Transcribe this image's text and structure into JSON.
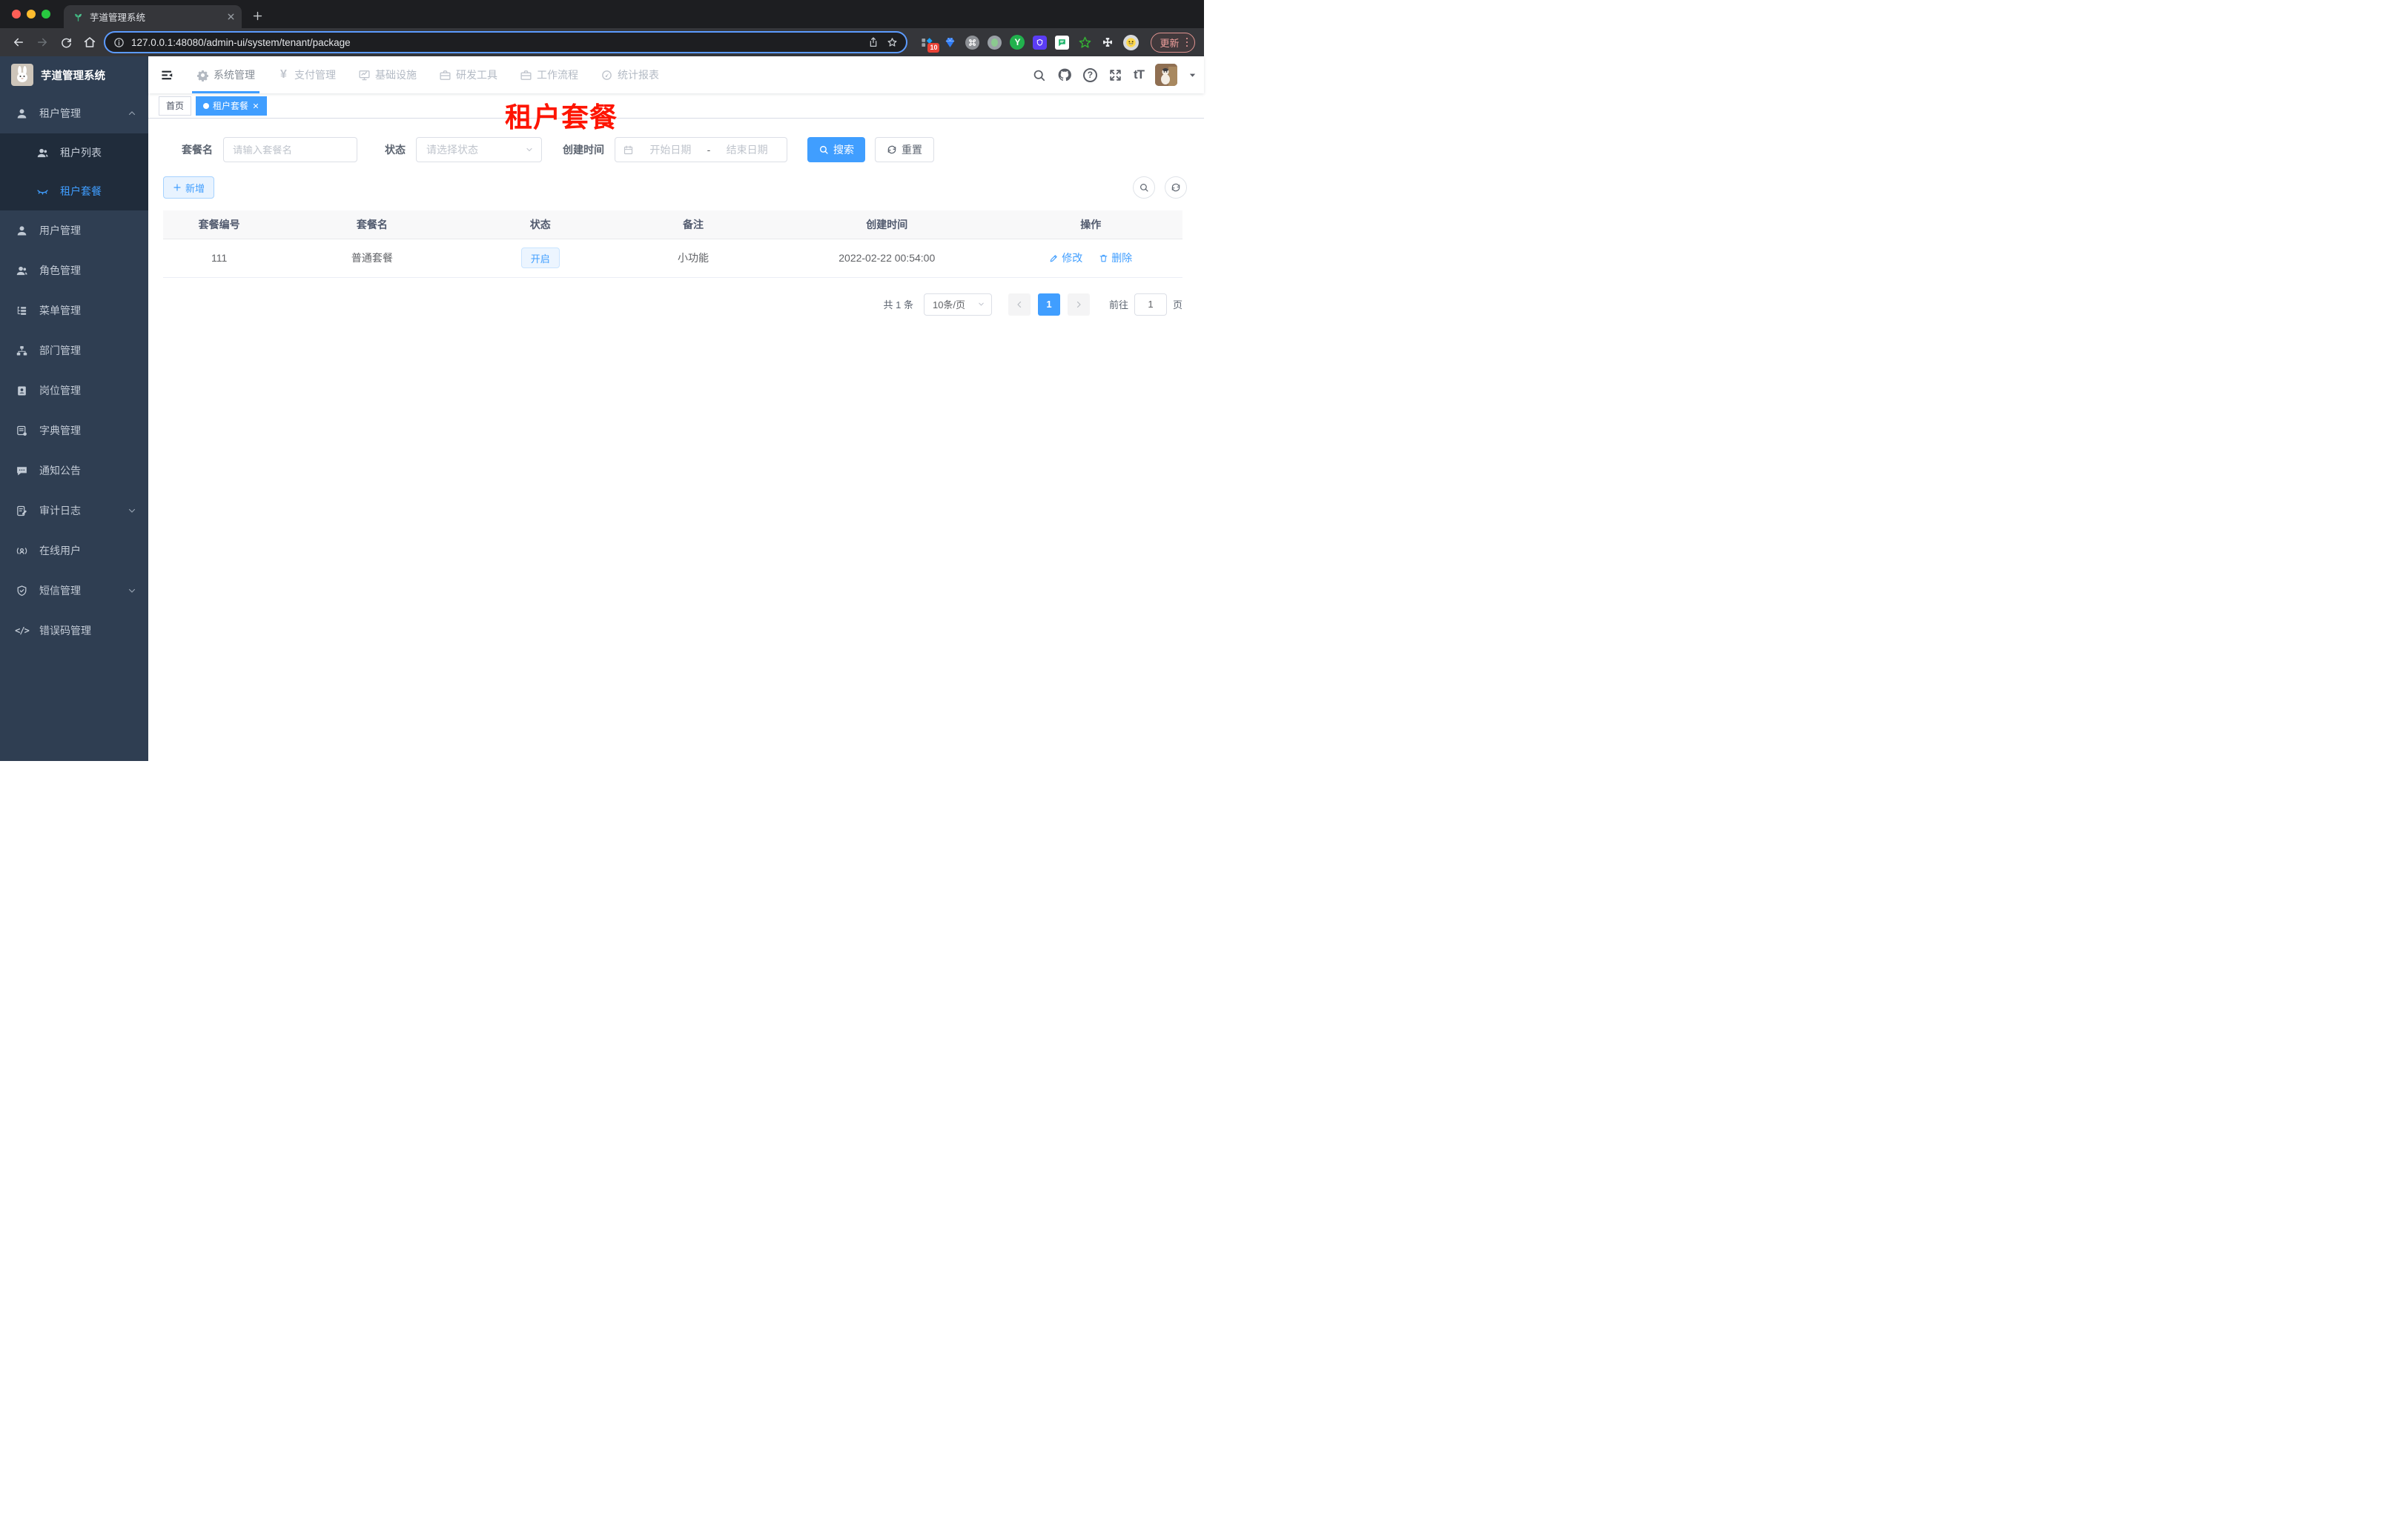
{
  "browser": {
    "tab_title": "芋道管理系统",
    "url": "127.0.0.1:48080/admin-ui/system/tenant/package",
    "update_label": "更新",
    "extension_badge": "10"
  },
  "sidebar": {
    "logo_title": "芋道管理系统",
    "items": [
      {
        "label": "租户管理"
      },
      {
        "label": "租户列表"
      },
      {
        "label": "租户套餐"
      },
      {
        "label": "用户管理"
      },
      {
        "label": "角色管理"
      },
      {
        "label": "菜单管理"
      },
      {
        "label": "部门管理"
      },
      {
        "label": "岗位管理"
      },
      {
        "label": "字典管理"
      },
      {
        "label": "通知公告"
      },
      {
        "label": "审计日志"
      },
      {
        "label": "在线用户"
      },
      {
        "label": "短信管理"
      },
      {
        "label": "错误码管理"
      }
    ]
  },
  "topnav": {
    "items": [
      "系统管理",
      "支付管理",
      "基础设施",
      "研发工具",
      "工作流程",
      "统计报表"
    ]
  },
  "tags": {
    "home": "首页",
    "active": "租户套餐"
  },
  "overlay_title": "租户套餐",
  "filter": {
    "name_label": "套餐名",
    "name_placeholder": "请输入套餐名",
    "status_label": "状态",
    "status_placeholder": "请选择状态",
    "date_label": "创建时间",
    "date_start": "开始日期",
    "date_separator": "-",
    "date_end": "结束日期",
    "search_label": "搜索",
    "reset_label": "重置"
  },
  "toolbar": {
    "add_label": "新增"
  },
  "table": {
    "headers": [
      "套餐编号",
      "套餐名",
      "状态",
      "备注",
      "创建时间",
      "操作"
    ],
    "rows": [
      {
        "id": "111",
        "name": "普通套餐",
        "status": "开启",
        "remark": "小功能",
        "created": "2022-02-22 00:54:00",
        "edit_label": "修改",
        "delete_label": "删除"
      }
    ]
  },
  "pagination": {
    "total": "共 1 条",
    "page_size": "10条/页",
    "current_page": "1",
    "goto_label": "前往",
    "goto_value": "1",
    "unit_label": "页"
  },
  "icons": {
    "yen": "¥",
    "code_glyph": "</>",
    "font_size": "tT",
    "help": "?",
    "y_logo": "Y"
  },
  "colors": {
    "accent": "#409eff",
    "annotation_red": "#fe1400",
    "sidebar_bg": "#2f3e52",
    "submenu_bg": "#202c3b",
    "status_tag_bg": "#ecf5ff"
  }
}
